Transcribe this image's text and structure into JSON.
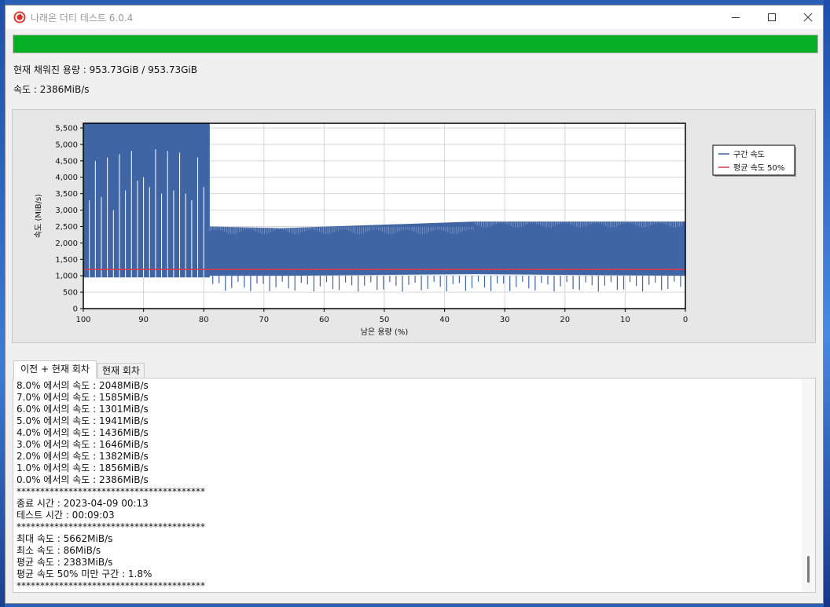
{
  "window": {
    "title": "나래온 더티 테스트 6.0.4",
    "icon": "app-logo-icon",
    "controls": [
      "minimize-icon",
      "maximize-icon",
      "close-icon"
    ]
  },
  "progress": {
    "value": 1.0,
    "color": "#06b025"
  },
  "status": {
    "capacity": "현재 채워진 용량 : 953.73GiB / 953.73GiB",
    "speed": "속도 : 2386MiB/s"
  },
  "chart_data": {
    "type": "area",
    "xlabel": "남은 용량 (%)",
    "ylabel": "속도 (MiB/s)",
    "xlim": [
      100,
      0
    ],
    "ylim": [
      0,
      5500
    ],
    "x_ticks": [
      100,
      90,
      80,
      70,
      60,
      50,
      40,
      30,
      20,
      10,
      0
    ],
    "y_ticks": [
      0,
      500,
      1000,
      1500,
      2000,
      2500,
      3000,
      3500,
      4000,
      4500,
      5000,
      5500
    ],
    "y_tick_labels": [
      "0",
      "500",
      "1,000",
      "1,500",
      "2,000",
      "2,500",
      "3,000",
      "3,500",
      "4,000",
      "4,500",
      "5,000",
      "5,500"
    ],
    "grid": true,
    "legend_position": "right",
    "series": [
      {
        "name": "구간 속도",
        "color": "#4065a5",
        "x": [
          100,
          79,
          79,
          67,
          35,
          0
        ],
        "y_high": [
          5662,
          5662,
          2500,
          2450,
          2650,
          2650
        ],
        "y_low": [
          950,
          950,
          1000,
          1000,
          1050,
          1000
        ],
        "dips_x": [
          99,
          98,
          97,
          96,
          95,
          94,
          93,
          92,
          91,
          90,
          89,
          88,
          87,
          86,
          85,
          84,
          83,
          82,
          81,
          80
        ],
        "dips_y": [
          3300,
          4500,
          3400,
          4600,
          3000,
          4700,
          3600,
          4800,
          3900,
          4000,
          3700,
          4850,
          3500,
          4800,
          3600,
          4750,
          3500,
          3300,
          4600,
          3700
        ]
      },
      {
        "name": "평균 속도 50%",
        "color": "#d83a4a",
        "x": [
          100,
          0
        ],
        "y": [
          1190,
          1190
        ]
      }
    ]
  },
  "tabs": [
    {
      "label": "이전 + 현재 회차",
      "active": true
    },
    {
      "label": "현재 회차",
      "active": false
    }
  ],
  "log": [
    "8.0% 에서의 속도 : 2048MiB/s",
    "7.0% 에서의 속도 : 1585MiB/s",
    "6.0% 에서의 속도 : 1301MiB/s",
    "5.0% 에서의 속도 : 1941MiB/s",
    "4.0% 에서의 속도 : 1436MiB/s",
    "3.0% 에서의 속도 : 1646MiB/s",
    "2.0% 에서의 속도 : 1382MiB/s",
    "1.0% 에서의 속도 : 1856MiB/s",
    "0.0% 에서의 속도 : 2386MiB/s",
    "****************************************",
    "종료 시간 : 2023-04-09 00:13",
    "테스트 시간 : 00:09:03",
    "****************************************",
    "최대 속도 : 5662MiB/s",
    "최소 속도 : 86MiB/s",
    "평균 속도 : 2383MiB/s",
    "평균 속도 50% 미만 구간 : 1.8%",
    "****************************************"
  ]
}
